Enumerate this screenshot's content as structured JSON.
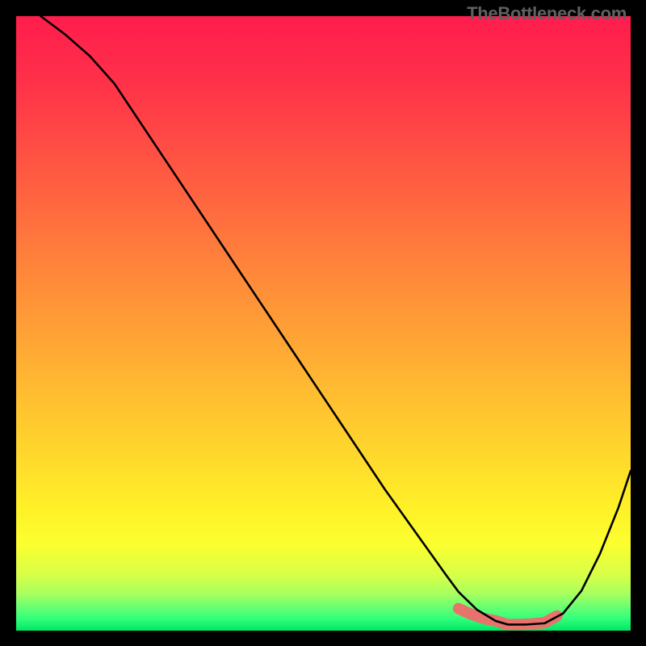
{
  "watermark": "TheBottleneck.com",
  "chart_data": {
    "type": "line",
    "title": "",
    "xlabel": "",
    "ylabel": "",
    "xlim": [
      0,
      100
    ],
    "ylim": [
      0,
      100
    ],
    "series": [
      {
        "name": "curve",
        "x": [
          4,
          8,
          12,
          16,
          20,
          25,
          30,
          35,
          40,
          45,
          50,
          55,
          60,
          65,
          70,
          72,
          75,
          78,
          80,
          83,
          86,
          89,
          92,
          95,
          98,
          100
        ],
        "values": [
          100,
          97,
          93.5,
          89,
          83,
          75.5,
          68,
          60.5,
          53,
          45.5,
          38,
          30.5,
          23,
          16,
          9,
          6.3,
          3.4,
          1.6,
          1.0,
          1.0,
          1.2,
          2.8,
          6.5,
          12.5,
          20,
          26
        ]
      },
      {
        "name": "zone-marker",
        "x": [
          72,
          74,
          76,
          78,
          80,
          82,
          84,
          86,
          88
        ],
        "values": [
          3.6,
          2.7,
          2.0,
          1.6,
          1.0,
          1.0,
          1.1,
          1.3,
          2.4
        ]
      }
    ],
    "gradient_stops": [
      {
        "offset": 0,
        "color": "#ff1d4d"
      },
      {
        "offset": 10,
        "color": "#ff2f49"
      },
      {
        "offset": 20,
        "color": "#ff4a45"
      },
      {
        "offset": 30,
        "color": "#ff6640"
      },
      {
        "offset": 40,
        "color": "#ff823b"
      },
      {
        "offset": 50,
        "color": "#ff9d36"
      },
      {
        "offset": 60,
        "color": "#ffb932"
      },
      {
        "offset": 70,
        "color": "#ffd42d"
      },
      {
        "offset": 80,
        "color": "#fff028"
      },
      {
        "offset": 86,
        "color": "#fbff2f"
      },
      {
        "offset": 91,
        "color": "#d6ff48"
      },
      {
        "offset": 94,
        "color": "#a7ff5e"
      },
      {
        "offset": 96,
        "color": "#6eff70"
      },
      {
        "offset": 98,
        "color": "#33ff7a"
      },
      {
        "offset": 100,
        "color": "#00e765"
      }
    ],
    "zone_color": "#e8726c",
    "zone_weight": 14
  }
}
